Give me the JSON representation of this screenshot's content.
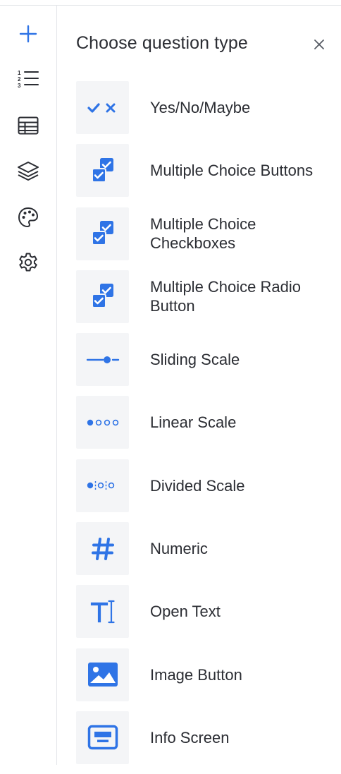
{
  "colors": {
    "accent": "#2f74e6",
    "tile_bg": "#f4f5f7",
    "text": "#2b2d33",
    "divider": "#e3e5e9"
  },
  "sidebar": {
    "items": [
      {
        "icon": "plus-icon"
      },
      {
        "icon": "numbered-list-icon"
      },
      {
        "icon": "table-icon"
      },
      {
        "icon": "layers-icon"
      },
      {
        "icon": "palette-icon"
      },
      {
        "icon": "gear-icon"
      }
    ]
  },
  "panel": {
    "title": "Choose question type",
    "close_icon": "close-icon",
    "question_types": [
      {
        "label": "Yes/No/Maybe",
        "icon": "check-cross-icon"
      },
      {
        "label": "Multiple Choice Buttons",
        "icon": "multi-check-icon"
      },
      {
        "label": "Multiple Choice Checkboxes",
        "icon": "multi-check-icon"
      },
      {
        "label": "Multiple Choice Radio Button",
        "icon": "multi-check-icon"
      },
      {
        "label": "Sliding Scale",
        "icon": "slider-icon"
      },
      {
        "label": "Linear Scale",
        "icon": "dots-scale-icon"
      },
      {
        "label": "Divided Scale",
        "icon": "divided-dots-icon"
      },
      {
        "label": "Numeric",
        "icon": "hash-icon"
      },
      {
        "label": "Open Text",
        "icon": "text-cursor-icon"
      },
      {
        "label": "Image Button",
        "icon": "image-icon"
      },
      {
        "label": "Info Screen",
        "icon": "info-screen-icon"
      }
    ]
  }
}
